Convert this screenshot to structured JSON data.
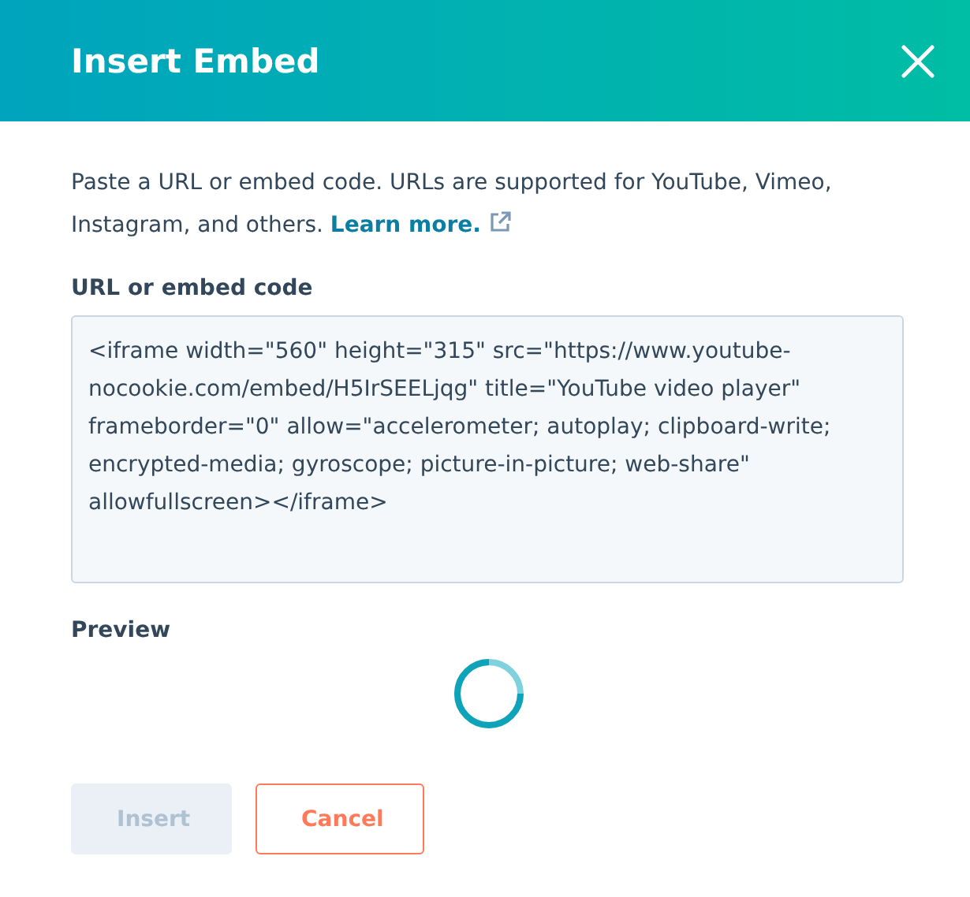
{
  "dialog": {
    "title": "Insert Embed"
  },
  "description": {
    "text": "Paste a URL or embed code. URLs are supported for YouTube, Vimeo, Instagram, and others.",
    "link": "Learn more."
  },
  "field": {
    "label": "URL or embed code",
    "value": "<iframe width=\"560\" height=\"315\" src=\"https://www.youtube-nocookie.com/embed/H5IrSEELjqg\" title=\"YouTube video player\" frameborder=\"0\" allow=\"accelerometer; autoplay; clipboard-write; encrypted-media; gyroscope; picture-in-picture; web-share\" allowfullscreen></iframe>"
  },
  "preview": {
    "label": "Preview",
    "loading": true
  },
  "buttons": [
    {
      "label": "Insert",
      "kind": "primary",
      "disabled": true
    },
    {
      "label": "Cancel",
      "kind": "secondary",
      "disabled": false
    }
  ]
}
